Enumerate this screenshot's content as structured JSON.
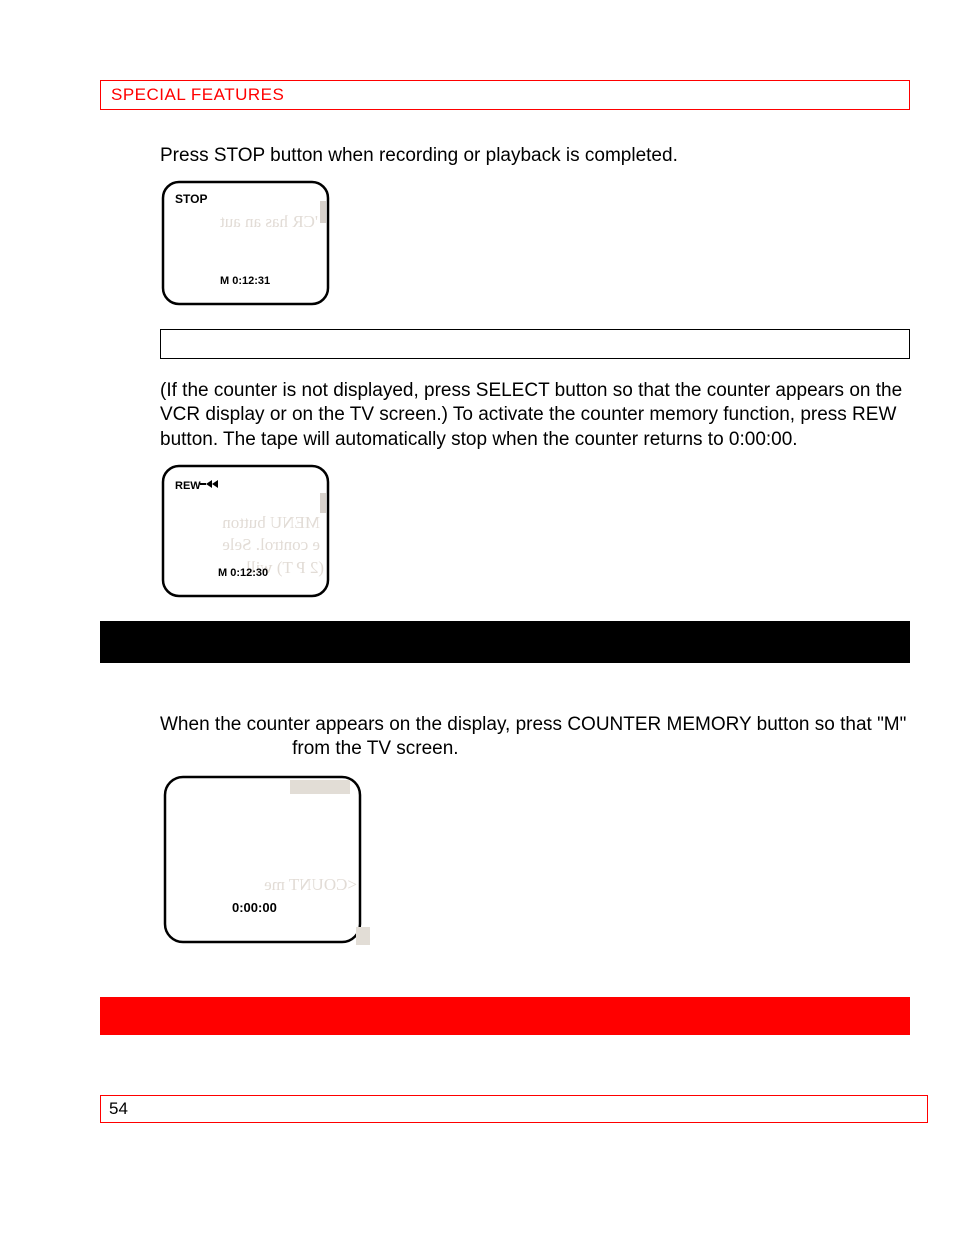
{
  "header": {
    "title": "SPECIAL FEATURES"
  },
  "para1": "Press STOP button when recording or playback is completed.",
  "fig1": {
    "label": "STOP",
    "counter": "M  0:12:31"
  },
  "para2": "(If the counter is not displayed, press SELECT button so that the counter appears on the VCR display or on the TV screen.)  To activate the counter memory function, press REW button.  The tape will automatically stop when the counter returns to 0:00:00.",
  "fig2": {
    "label": "REW",
    "counter": "M  0:12:30"
  },
  "para3_a": "When the counter appears on the display, press COUNTER MEMORY button so that \"M\"",
  "para3_b": "from the TV screen.",
  "fig3": {
    "counter": "0:00:00"
  },
  "footer": {
    "page": "54"
  }
}
